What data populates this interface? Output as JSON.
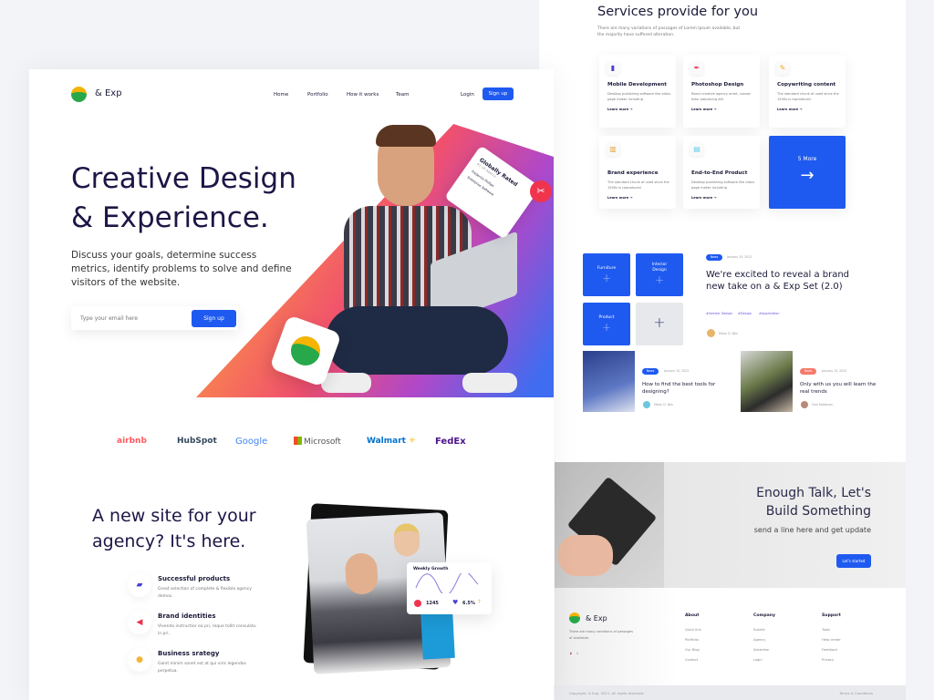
{
  "services": {
    "title": "Services provide for you",
    "subtitle": "There are many variations of passages of Lorem Ipsum available, but the majority have suffered alteration.",
    "cards": [
      {
        "title": "Mobile Development",
        "desc": "Desktop publishing software like aldus page maker including",
        "link": "Learn more →",
        "icon": "phone-icon",
        "color": "#4b3fd1"
      },
      {
        "title": "Photoshop Design",
        "desc": "React creative agency amet, consec tetur adipiscing elit.",
        "link": "Learn more →",
        "icon": "pen-icon",
        "color": "#e8344e"
      },
      {
        "title": "Copywriting content",
        "desc": "The standard chunk of used since the 1500s is reproduced",
        "link": "Learn more →",
        "icon": "pencil-icon",
        "color": "#f5a623"
      },
      {
        "title": "Brand experience",
        "desc": "The standard chunk of used since the 1500s is reproduced",
        "link": "Learn more →",
        "icon": "chart-icon",
        "color": "#e9a43a"
      },
      {
        "title": "End-to-End Product",
        "desc": "Desktop publishing software like aldus page maker including",
        "link": "Learn more →",
        "icon": "box-icon",
        "color": "#5ccbea"
      }
    ],
    "more_label": "5 More"
  },
  "categories": [
    "Furniture",
    "Interior Design",
    "Product"
  ],
  "news": {
    "badge": "News",
    "date": "January 15, 2022",
    "headline": "We're excited to reveal a brand new take on a & Exp Set (2.0)",
    "tags": [
      "#Interior Design",
      "#Design",
      "#Application"
    ],
    "author": "Ethan D. Ben",
    "posts": [
      {
        "badge": "News",
        "date": "January 15, 2022",
        "title": "How to find the best tools for designing?",
        "author": "Ethan D. Ben"
      },
      {
        "badge": "News",
        "date": "January 15, 2022",
        "title": "Only with us you will learn the real trends",
        "author": "Fora Kokkonen"
      }
    ]
  },
  "cta": {
    "title": "Enough Talk, Let's Build Something",
    "subtitle": "send a line here and get update",
    "button": "Let's started"
  },
  "footer": {
    "brand": "& Exp",
    "desc": "There are many variations of passages of available.",
    "cols": [
      {
        "title": "About",
        "items": [
          "Quick link",
          "Portfolio",
          "Our Blog",
          "Contact"
        ]
      },
      {
        "title": "Company",
        "items": [
          "Submit",
          "Agency",
          "Advertise",
          "Login"
        ]
      },
      {
        "title": "Support",
        "items": [
          "Tools",
          "Help center",
          "Feedback",
          "Privacy"
        ]
      }
    ],
    "copyright": "Copyright, & Exp. 2021. All rights reserved.",
    "terms": "Terms & Conditions"
  },
  "header": {
    "brand": "& Exp",
    "nav": [
      "Home",
      "Portfolio",
      "How it works",
      "Team"
    ],
    "login": "Login",
    "signup": "Sign up"
  },
  "hero": {
    "title1": "Creative Design",
    "title2": "& Experience.",
    "text": "Discuss your goals, determine success metrics, identify problems to solve and define visitors of the website.",
    "email_placeholder": "Type your email here",
    "signup": "Sign up",
    "rated_title": "Globally Rated",
    "rated_sub": "#1 UX Agency",
    "reviewers": [
      "Frederick Phillips",
      "Enterprise Software"
    ]
  },
  "brands": [
    "airbnb",
    "HubSpot",
    "Google",
    "Microsoft",
    "Walmart",
    "FedEx"
  ],
  "agency": {
    "title": "A new site for your agency? It's here.",
    "features": [
      {
        "title": "Successful products",
        "desc": "Great selection of complete & flexible agency demos."
      },
      {
        "title": "Brand identities",
        "desc": "Vivendo instructior ea pri, reque tollit consulatu in pri."
      },
      {
        "title": "Business srategy",
        "desc": "Gaint minim sonet est at qui viris legendos perpetua."
      }
    ],
    "growth": {
      "title": "Weekly Growth",
      "count": "1245",
      "percent": "6.5%"
    }
  }
}
